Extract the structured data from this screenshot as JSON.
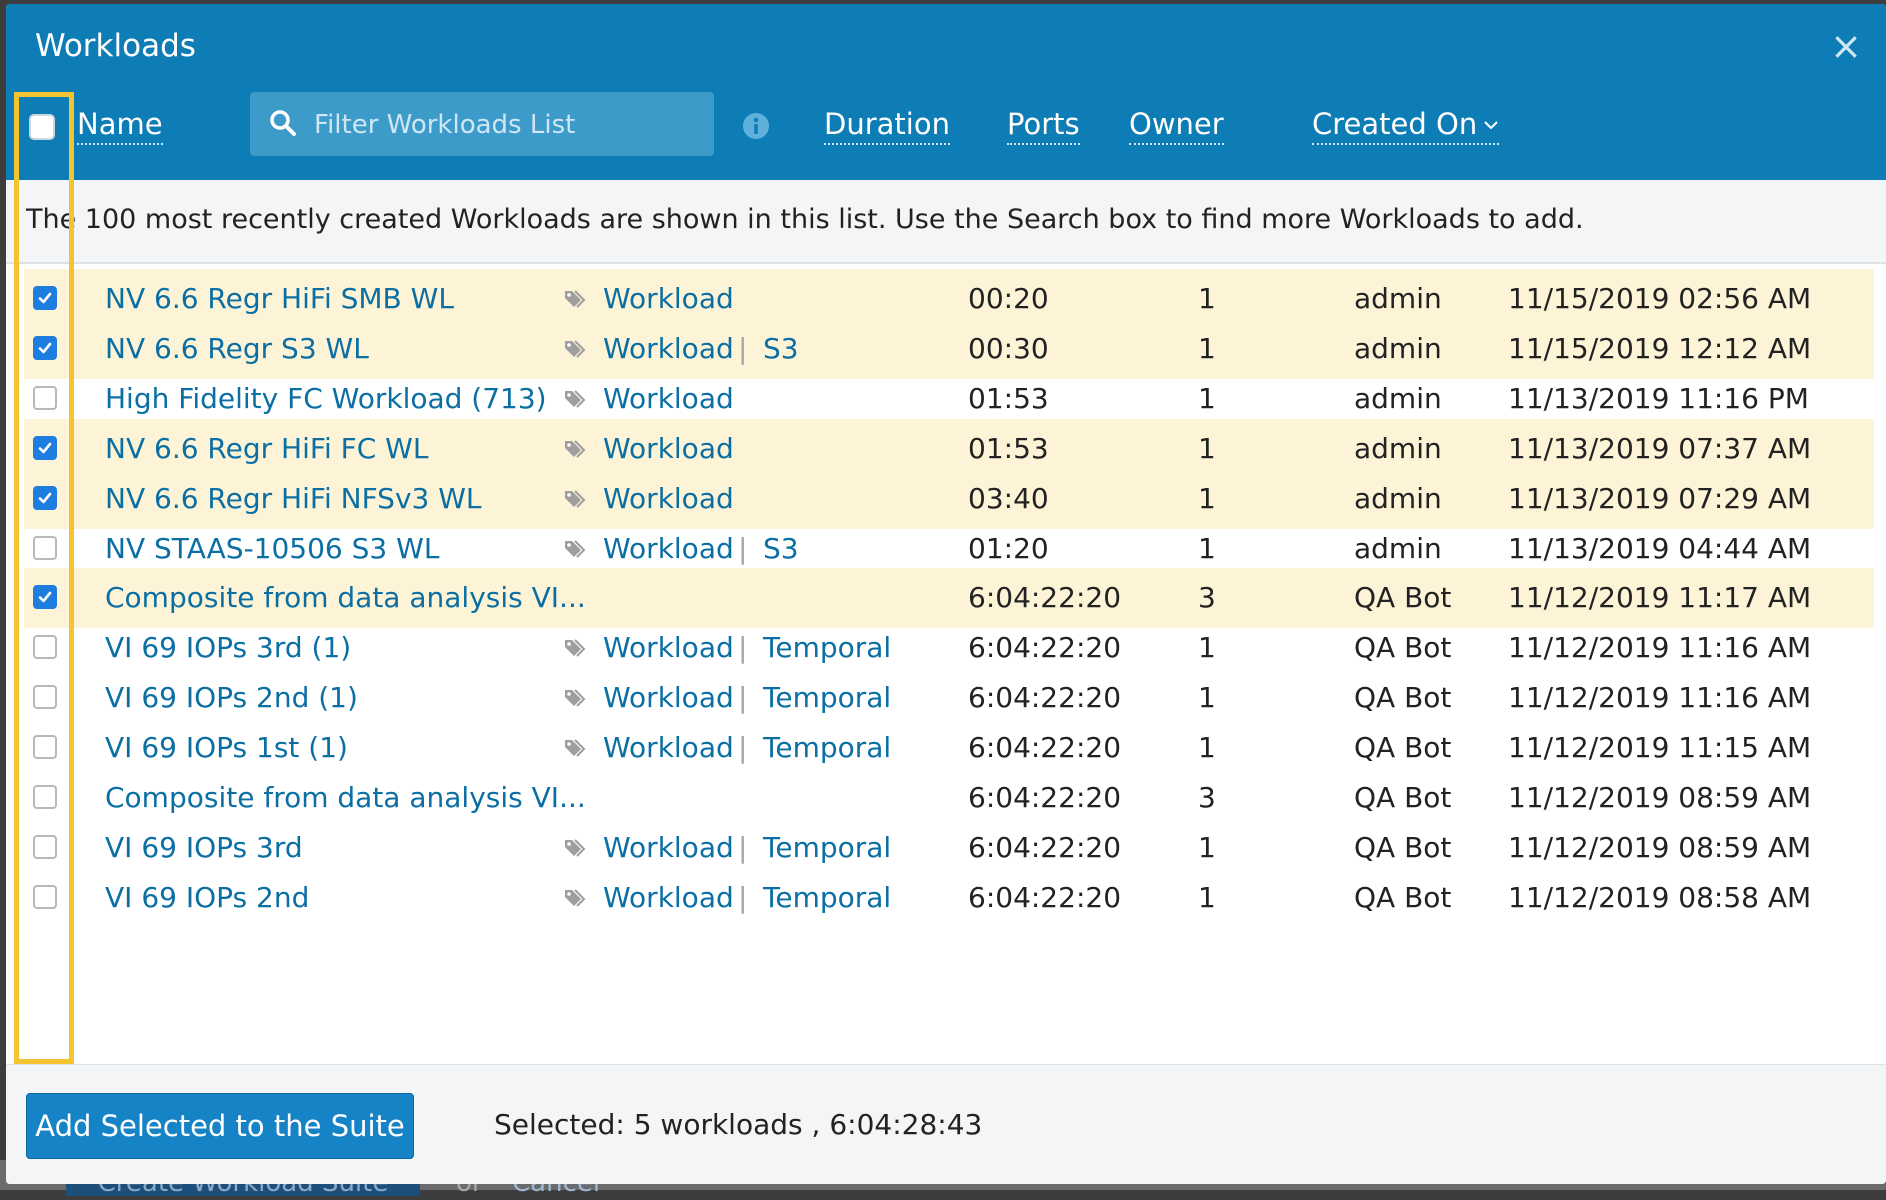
{
  "backdrop": {
    "create_button_label": "Create Workload Suite",
    "or_label": "or",
    "cancel_label": "Cancel"
  },
  "modal": {
    "title": "Workloads",
    "close_glyph": "×"
  },
  "columns": {
    "name": "Name",
    "duration": "Duration",
    "ports": "Ports",
    "owner": "Owner",
    "created_on": "Created On"
  },
  "filter": {
    "placeholder": "Filter Workloads List"
  },
  "notice": "The 100 most recently created Workloads are shown in this list. Use the Search box to find more Workloads to add.",
  "icons": {
    "search": "search-icon",
    "info": "info-icon",
    "tag": "tag-icon",
    "close": "close-icon",
    "checkmark": "checkmark-icon",
    "sort": "chevron-down-icon"
  },
  "colors": {
    "header_bg": "#0e7db5",
    "link": "#0b6fa4",
    "selected_row": "#fdf4d7",
    "highlight_box": "#f4c430",
    "checkbox_on": "#1d7ee0",
    "button": "#1583c6"
  },
  "rows": [
    {
      "checked": true,
      "name": "NV 6.6 Regr HiFi SMB WL",
      "tag1": "Workload",
      "tag2": "",
      "duration": "00:20",
      "ports": "1",
      "owner": "admin",
      "created": "11/15/2019 02:56 AM"
    },
    {
      "checked": true,
      "name": "NV 6.6 Regr S3 WL",
      "tag1": "Workload",
      "tag2": "S3",
      "duration": "00:30",
      "ports": "1",
      "owner": "admin",
      "created": "11/15/2019 12:12 AM"
    },
    {
      "checked": false,
      "name": "High Fidelity FC Workload (713)",
      "tag1": "Workload",
      "tag2": "",
      "duration": "01:53",
      "ports": "1",
      "owner": "admin",
      "created": "11/13/2019 11:16 PM"
    },
    {
      "checked": true,
      "name": "NV 6.6 Regr HiFi FC WL",
      "tag1": "Workload",
      "tag2": "",
      "duration": "01:53",
      "ports": "1",
      "owner": "admin",
      "created": "11/13/2019 07:37 AM"
    },
    {
      "checked": true,
      "name": "NV 6.6 Regr HiFi NFSv3 WL",
      "tag1": "Workload",
      "tag2": "",
      "duration": "03:40",
      "ports": "1",
      "owner": "admin",
      "created": "11/13/2019 07:29 AM"
    },
    {
      "checked": false,
      "name": "NV STAAS-10506 S3 WL",
      "tag1": "Workload",
      "tag2": "S3",
      "duration": "01:20",
      "ports": "1",
      "owner": "admin",
      "created": "11/13/2019 04:44 AM"
    },
    {
      "checked": true,
      "name": "Composite from data analysis VI...",
      "tag1": "",
      "tag2": "",
      "duration": "6:04:22:20",
      "ports": "3",
      "owner": "QA Bot",
      "created": "11/12/2019 11:17 AM"
    },
    {
      "checked": false,
      "name": "VI 69 IOPs 3rd (1)",
      "tag1": "Workload",
      "tag2": "Temporal",
      "duration": "6:04:22:20",
      "ports": "1",
      "owner": "QA Bot",
      "created": "11/12/2019 11:16 AM"
    },
    {
      "checked": false,
      "name": "VI 69 IOPs 2nd (1)",
      "tag1": "Workload",
      "tag2": "Temporal",
      "duration": "6:04:22:20",
      "ports": "1",
      "owner": "QA Bot",
      "created": "11/12/2019 11:16 AM"
    },
    {
      "checked": false,
      "name": "VI 69 IOPs 1st (1)",
      "tag1": "Workload",
      "tag2": "Temporal",
      "duration": "6:04:22:20",
      "ports": "1",
      "owner": "QA Bot",
      "created": "11/12/2019 11:15 AM"
    },
    {
      "checked": false,
      "name": "Composite from data analysis VI...",
      "tag1": "",
      "tag2": "",
      "duration": "6:04:22:20",
      "ports": "3",
      "owner": "QA Bot",
      "created": "11/12/2019 08:59 AM"
    },
    {
      "checked": false,
      "name": "VI 69 IOPs 3rd",
      "tag1": "Workload",
      "tag2": "Temporal",
      "duration": "6:04:22:20",
      "ports": "1",
      "owner": "QA Bot",
      "created": "11/12/2019 08:59 AM"
    },
    {
      "checked": false,
      "name": "VI 69 IOPs 2nd",
      "tag1": "Workload",
      "tag2": "Temporal",
      "duration": "6:04:22:20",
      "ports": "1",
      "owner": "QA Bot",
      "created": "11/12/2019 08:58 AM"
    }
  ],
  "footer": {
    "add_button_label": "Add Selected to the Suite",
    "selected_text": "Selected: 5 workloads , 6:04:28:43"
  }
}
